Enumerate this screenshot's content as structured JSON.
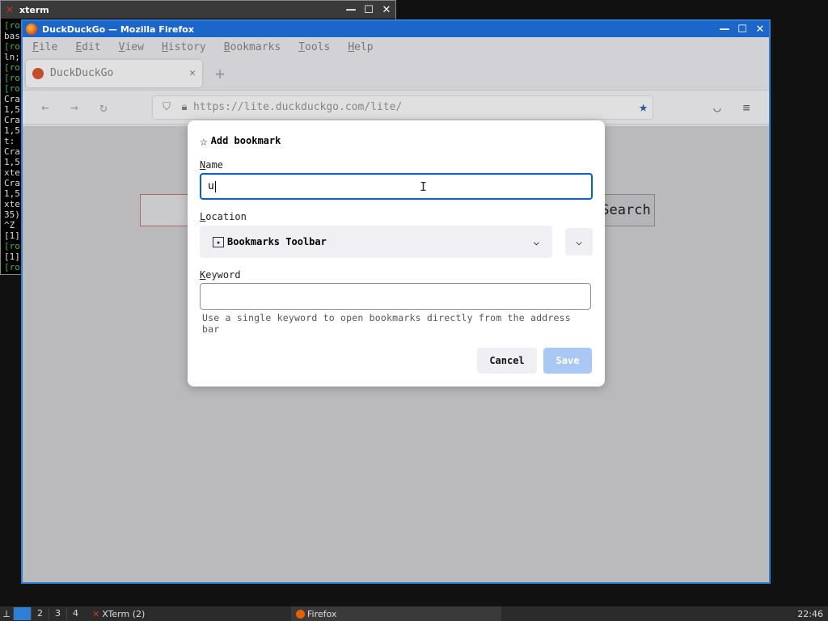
{
  "xterm": {
    "title": "xterm",
    "lines": [
      "[ro",
      "bas",
      "[ro",
      "ln;",
      "[ro",
      "[ro",
      "[ro",
      "Cra",
      "1,5",
      "Cra",
      "1,5",
      "t: ",
      "Cra",
      "1,5",
      "xte",
      "Cra",
      "1,5",
      "xte",
      "35)",
      "^Z",
      "[1]",
      "[ro",
      "[1]",
      "[ro"
    ]
  },
  "firefox": {
    "window_title": "DuckDuckGo — Mozilla Firefox",
    "menu": [
      "File",
      "Edit",
      "View",
      "History",
      "Bookmarks",
      "Tools",
      "Help"
    ],
    "tab_title": "DuckDuckGo",
    "url": "https://lite.duckduckgo.com/lite/",
    "page": {
      "search_button": "Search"
    }
  },
  "dialog": {
    "title": "Add bookmark",
    "name_label": "Name",
    "name_value": "u",
    "location_label": "Location",
    "location_value": "Bookmarks Toolbar",
    "keyword_label": "Keyword",
    "keyword_value": "",
    "hint": "Use a single keyword to open bookmarks directly from the address bar",
    "cancel": "Cancel",
    "save": "Save"
  },
  "taskbar": {
    "workspaces": [
      "2",
      "3",
      "4"
    ],
    "xterm_task": "XTerm (2)",
    "firefox_task": "Firefox",
    "clock": "22:46"
  },
  "colors": {
    "accent": "#0061e0",
    "title_bar": "#1d66c9",
    "star": "#2e62b8"
  }
}
